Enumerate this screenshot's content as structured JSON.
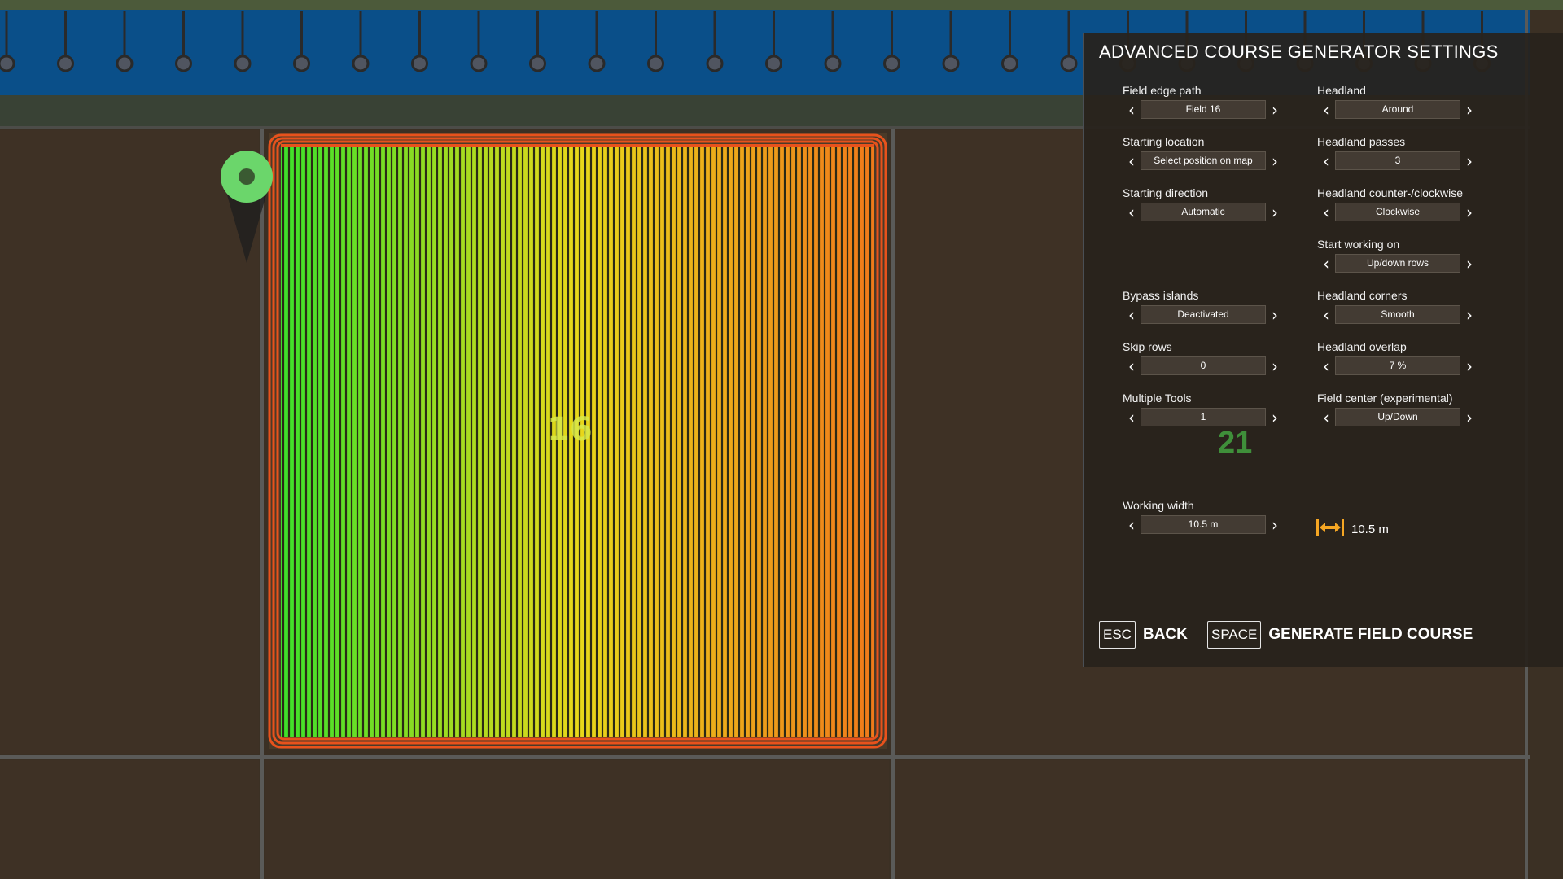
{
  "map": {
    "field_number": "16"
  },
  "panel": {
    "title": "ADVANCED COURSE GENERATOR SETTINGS",
    "settings": [
      {
        "label": "Field edge path",
        "value": "Field 16"
      },
      {
        "label": "Headland",
        "value": "Around"
      },
      {
        "label": "Starting location",
        "value": "Select position on map"
      },
      {
        "label": "Headland passes",
        "value": "3"
      },
      {
        "label": "Starting direction",
        "value": "Automatic"
      },
      {
        "label": "Headland counter-/clockwise",
        "value": "Clockwise"
      },
      {
        "label": "Start working on",
        "value": "Up/down rows"
      },
      {
        "label": "Bypass islands",
        "value": "Deactivated"
      },
      {
        "label": "Headland corners",
        "value": "Smooth"
      },
      {
        "label": "Skip rows",
        "value": "0"
      },
      {
        "label": "Headland overlap",
        "value": "7 %"
      },
      {
        "label": "Multiple Tools",
        "value": "1"
      },
      {
        "label": "Field center (experimental)",
        "value": "Up/Down"
      },
      {
        "label": "Working width",
        "value": "10.5 m"
      }
    ],
    "tools_count": "21",
    "width_display": "10.5 m",
    "icons": {
      "prev": "chevron-left-icon",
      "next": "chevron-right-icon",
      "width": "width-arrows-icon"
    },
    "footer": {
      "back_key": "ESC",
      "back_label": "BACK",
      "generate_key": "SPACE",
      "generate_label": "GENERATE FIELD COURSE"
    }
  }
}
